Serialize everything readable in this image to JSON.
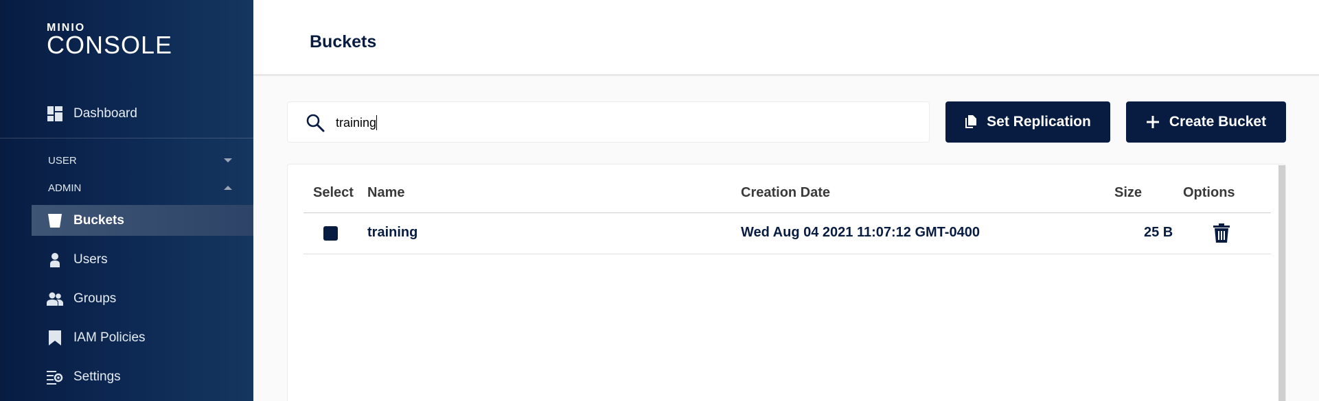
{
  "logo": {
    "brand": "MINIO",
    "product": "CONSOLE"
  },
  "sidebar": {
    "dashboard": {
      "label": "Dashboard",
      "icon": "dashboard-icon"
    },
    "sections": {
      "user": "USER",
      "admin": "ADMIN"
    },
    "items": [
      {
        "label": "Buckets",
        "icon": "bucket-icon",
        "active": true
      },
      {
        "label": "Users",
        "icon": "user-icon"
      },
      {
        "label": "Groups",
        "icon": "groups-icon"
      },
      {
        "label": "IAM Policies",
        "icon": "bookmark-icon"
      },
      {
        "label": "Settings",
        "icon": "settings-icon"
      }
    ]
  },
  "header": {
    "title": "Buckets"
  },
  "search": {
    "value": "training"
  },
  "toolbar": {
    "set_replication_label": "Set Replication",
    "create_bucket_label": "Create Bucket"
  },
  "table": {
    "columns": [
      "Select",
      "Name",
      "Creation Date",
      "Size",
      "Options"
    ],
    "rows": [
      {
        "name": "training",
        "creation_date": "Wed Aug 04 2021 11:07:12 GMT-0400",
        "size": "25 B"
      }
    ]
  },
  "colors": {
    "primary": "#081c42",
    "sidebar_active": "#3f5575"
  }
}
